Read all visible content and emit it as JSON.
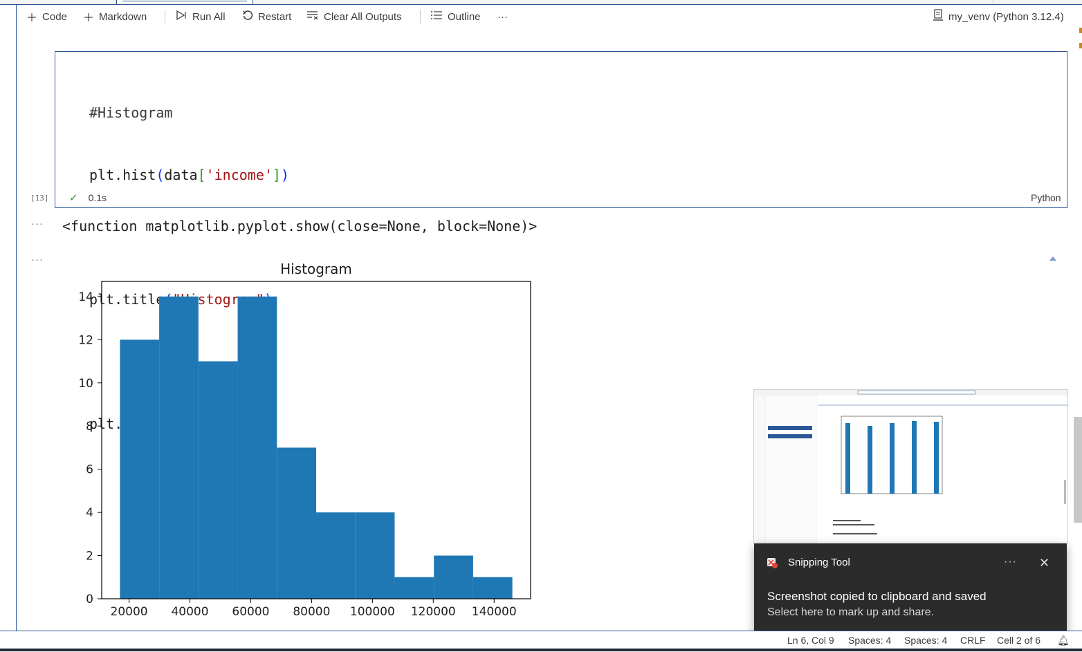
{
  "toolbar": {
    "code_label": "Code",
    "markdown_label": "Markdown",
    "run_all_label": "Run All",
    "restart_label": "Restart",
    "clear_outputs_label": "Clear All Outputs",
    "outline_label": "Outline",
    "more_label": "···",
    "kernel_label": "my_venv (Python 3.12.4)"
  },
  "cell": {
    "execution_count": "[13]",
    "code_lines": [
      "#Histogram",
      "plt.hist(data['income'])",
      "",
      "plt.title(\"Histogram\")",
      "",
      "plt.show"
    ],
    "duration": "0.1s",
    "language": "Python"
  },
  "outputs": {
    "dots": "···",
    "text_output": "<function matplotlib.pyplot.show(close=None, block=None)>"
  },
  "chart_data": {
    "type": "bar",
    "title": "Histogram",
    "xlabel": "",
    "ylabel": "",
    "bin_edges": [
      17000,
      29900,
      42800,
      55700,
      68600,
      81500,
      94400,
      107300,
      120200,
      133100,
      146000
    ],
    "values": [
      12,
      14,
      11,
      14,
      7,
      4,
      4,
      1,
      2,
      1
    ],
    "xlim": [
      11000,
      152000
    ],
    "ylim": [
      0,
      14.7
    ],
    "xticks": [
      20000,
      40000,
      60000,
      80000,
      100000,
      120000,
      140000
    ],
    "yticks": [
      0,
      2,
      4,
      6,
      8,
      10,
      12,
      14
    ],
    "color": "#1f77b4",
    "grid": false
  },
  "toast": {
    "app_name": "Snipping Tool",
    "more_label": "···",
    "close_label": "✕",
    "message": "Screenshot copied to clipboard and saved",
    "sub_message": "Select here to mark up and share."
  },
  "statusbar": {
    "position": "Ln 6, Col 9",
    "spaces1": "Spaces: 4",
    "spaces2": "Spaces: 4",
    "eol": "CRLF",
    "cell": "Cell 2 of 6"
  },
  "colors": {
    "accent": "#2b5797",
    "success": "#388a34",
    "toast_bg": "#2b2b2b",
    "bar": "#1f77b4"
  }
}
